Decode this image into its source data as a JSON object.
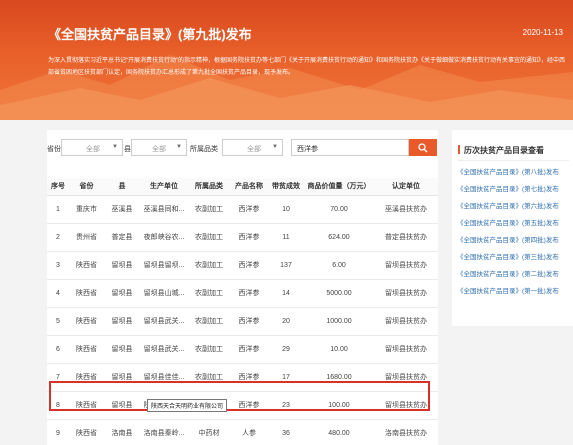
{
  "banner": {
    "title": "《全国扶贫产品目录》(第九批)发布",
    "date": "2020-11-13",
    "description": "为深入贯彻落实习近平总书记“开展消费扶贫行动”的指示精神，根据国务院扶贫办等七部门《关于开展消费扶贫行动的通知》和国务院扶贫办《关于做细做实消费扶贫行动有关事宜的通知》，经中西部省贫困地区扶贫部门认定，国务院扶贫办汇总形成了第九批全国扶贫产品目录，现予发布。"
  },
  "filters": {
    "province_label": "省份",
    "province_value": "全部",
    "county_label": "县",
    "county_value": "全部",
    "category_label": "所属品类",
    "category_value": "全部",
    "search_value": "西洋参"
  },
  "table": {
    "headers": [
      "序号",
      "省份",
      "县",
      "生产单位",
      "所属品类",
      "产品名称",
      "带贫成效",
      "商品价值量（万元）",
      "认定单位"
    ],
    "rows": [
      [
        "1",
        "重庆市",
        "巫溪县",
        "巫溪县同和...",
        "农副加工",
        "西洋参",
        "10",
        "70.00",
        "巫溪县扶贫办"
      ],
      [
        "2",
        "贵州省",
        "普定县",
        "夜郎峡谷农...",
        "农副加工",
        "西洋参",
        "11",
        "624.00",
        "普定县扶贫办"
      ],
      [
        "3",
        "陕西省",
        "留坝县",
        "留坝县留坝...",
        "农副加工",
        "西洋参",
        "137",
        "6.00",
        "留坝县扶贫办"
      ],
      [
        "4",
        "陕西省",
        "留坝县",
        "留坝县山城...",
        "农副加工",
        "西洋参",
        "14",
        "5000.00",
        "留坝县扶贫办"
      ],
      [
        "5",
        "陕西省",
        "留坝县",
        "留坝县武关...",
        "农副加工",
        "西洋参",
        "20",
        "1000.00",
        "留坝县扶贫办"
      ],
      [
        "6",
        "陕西省",
        "留坝县",
        "留坝县武关...",
        "农副加工",
        "西洋参",
        "29",
        "10.00",
        "留坝县扶贫办"
      ],
      [
        "7",
        "陕西省",
        "留坝县",
        "留坝县佳佳...",
        "农副加工",
        "西洋参",
        "17",
        "1680.00",
        "留坝县扶贫办"
      ],
      [
        "8",
        "陕西省",
        "留坝县",
        "陕西天合天...",
        "农副加工",
        "西洋参",
        "23",
        "100.00",
        "留坝县扶贫办"
      ],
      [
        "9",
        "陕西省",
        "洛南县",
        "洛南县秦岭...",
        "中药材",
        "人参",
        "36",
        "480.00",
        "洛南县扶贫办"
      ]
    ],
    "tooltip": "陕西天合天明药业有限公司"
  },
  "sidebar": {
    "title": "历次扶贫产品目录查看",
    "items": [
      "《全国扶贫产品目录》(第八批)发布",
      "《全国扶贫产品目录》(第七批)发布",
      "《全国扶贫产品目录》(第六批)发布",
      "《全国扶贫产品目录》(第五批)发布",
      "《全国扶贫产品目录》(第四批)发布",
      "《全国扶贫产品目录》(第三批)发布",
      "《全国扶贫产品目录》(第二批)发布",
      "《全国扶贫产品目录》(第一批)发布"
    ]
  },
  "colors": {
    "accent": "#e9592a",
    "link": "#2f6fb0",
    "highlight": "#d9302a"
  }
}
